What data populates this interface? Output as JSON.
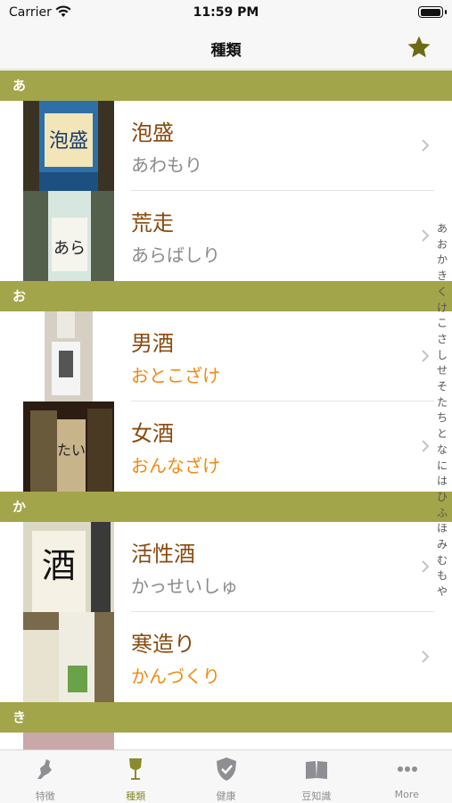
{
  "status": {
    "carrier": "Carrier",
    "time": "11:59 PM",
    "battery_level": 0.9
  },
  "nav": {
    "title": "種類"
  },
  "sections": [
    {
      "header": "あ",
      "rows": [
        {
          "name": "泡盛",
          "reading": "あわもり",
          "highlight": false
        },
        {
          "name": "荒走",
          "reading": "あらばしり",
          "highlight": false
        }
      ]
    },
    {
      "header": "お",
      "rows": [
        {
          "name": "男酒",
          "reading": "おとこざけ",
          "highlight": true
        },
        {
          "name": "女酒",
          "reading": "おんなざけ",
          "highlight": true
        }
      ]
    },
    {
      "header": "か",
      "rows": [
        {
          "name": "活性酒",
          "reading": "かっせいしゅ",
          "highlight": false
        },
        {
          "name": "寒造り",
          "reading": "かんづくり",
          "highlight": true
        }
      ]
    },
    {
      "header": "き",
      "rows": []
    }
  ],
  "index": [
    "あ",
    "お",
    "か",
    "き",
    "く",
    "け",
    "こ",
    "さ",
    "し",
    "せ",
    "そ",
    "た",
    "ち",
    "と",
    "な",
    "に",
    "は",
    "ひ",
    "ふ",
    "ほ",
    "み",
    "む",
    "も",
    "や"
  ],
  "tabs": [
    {
      "label": "特徴",
      "icon": "map-icon",
      "active": false
    },
    {
      "label": "種類",
      "icon": "glass-icon",
      "active": true
    },
    {
      "label": "健康",
      "icon": "shield-check-icon",
      "active": false
    },
    {
      "label": "豆知識",
      "icon": "book-icon",
      "active": false
    },
    {
      "label": "More",
      "icon": "more-icon",
      "active": false
    }
  ],
  "colors": {
    "accent": "#a3a54a",
    "name": "#8a4b0f",
    "reading_highlight": "#f08a10",
    "reading": "#8a8a8a"
  }
}
